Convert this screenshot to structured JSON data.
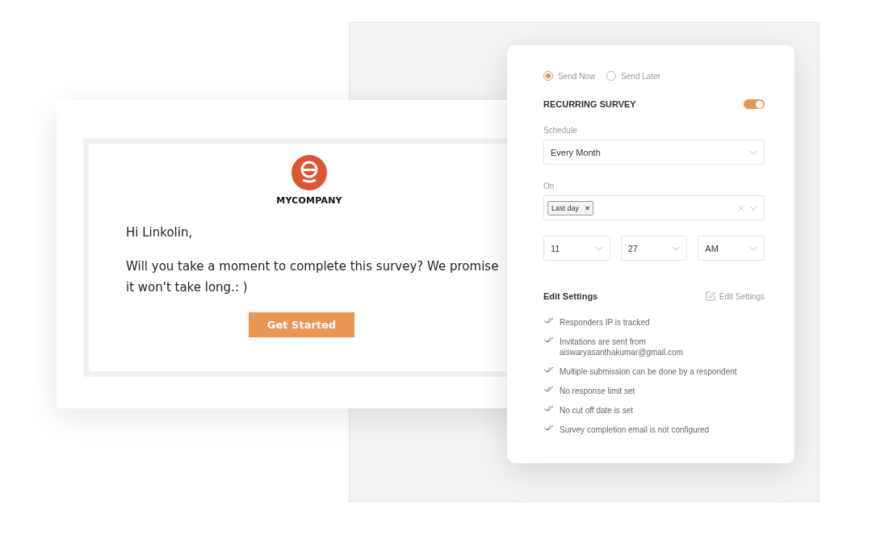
{
  "email": {
    "brand": "MYCOMPANY",
    "greeting": "Hi Linkolin,",
    "message": "Will you take a moment to complete this survey? We promise it won't take long.: )",
    "button": "Get Started"
  },
  "settings": {
    "send_options": [
      {
        "label": "Send Now",
        "selected": true
      },
      {
        "label": "Send Later",
        "selected": false
      }
    ],
    "recurring": {
      "label": "RECURRING SURVEY",
      "on": true
    },
    "schedule": {
      "label": "Schedule",
      "value": "Every Month"
    },
    "on": {
      "label": "On",
      "tags": [
        "Last day"
      ],
      "remove": "×"
    },
    "time": [
      {
        "value": "11"
      },
      {
        "value": "27"
      },
      {
        "value": "AM"
      }
    ],
    "edit_heading": "Edit Settings",
    "edit_link": "Edit Settings",
    "items": [
      "Responders IP is tracked",
      "Invitations are sent from aiswaryasanthakumar@gmail.com",
      "Multiple submission can be done by a respondent",
      "No response limit set",
      "No cut off date is set",
      "Survey completion email is not configured"
    ]
  }
}
